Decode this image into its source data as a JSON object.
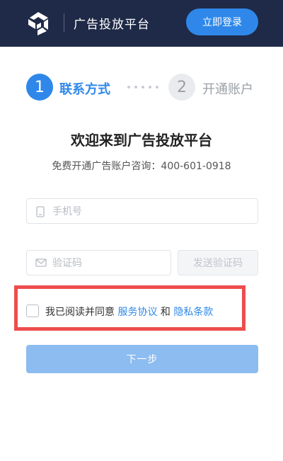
{
  "header": {
    "title": "广告投放平台",
    "login_label": "立即登录",
    "logo_icon": "cube-logo-icon"
  },
  "steps": [
    {
      "number": "1",
      "label": "联系方式",
      "active": true
    },
    {
      "number": "2",
      "label": "开通账户",
      "active": false
    }
  ],
  "welcome": {
    "title": "欢迎来到广告投放平台",
    "subtitle": "免费开通广告账户咨询：400-601-0918"
  },
  "form": {
    "phone_placeholder": "手机号",
    "code_placeholder": "验证码",
    "send_code_label": "发送验证码",
    "agree_prefix": "我已阅读并同意",
    "agree_link1": "服务协议",
    "agree_and": "和",
    "agree_link2": "隐私条款",
    "agree_checked": false,
    "next_label": "下一步"
  },
  "colors": {
    "header_bg": "#1e2a47",
    "accent": "#2f88e9",
    "highlight": "#ee4d4d"
  }
}
